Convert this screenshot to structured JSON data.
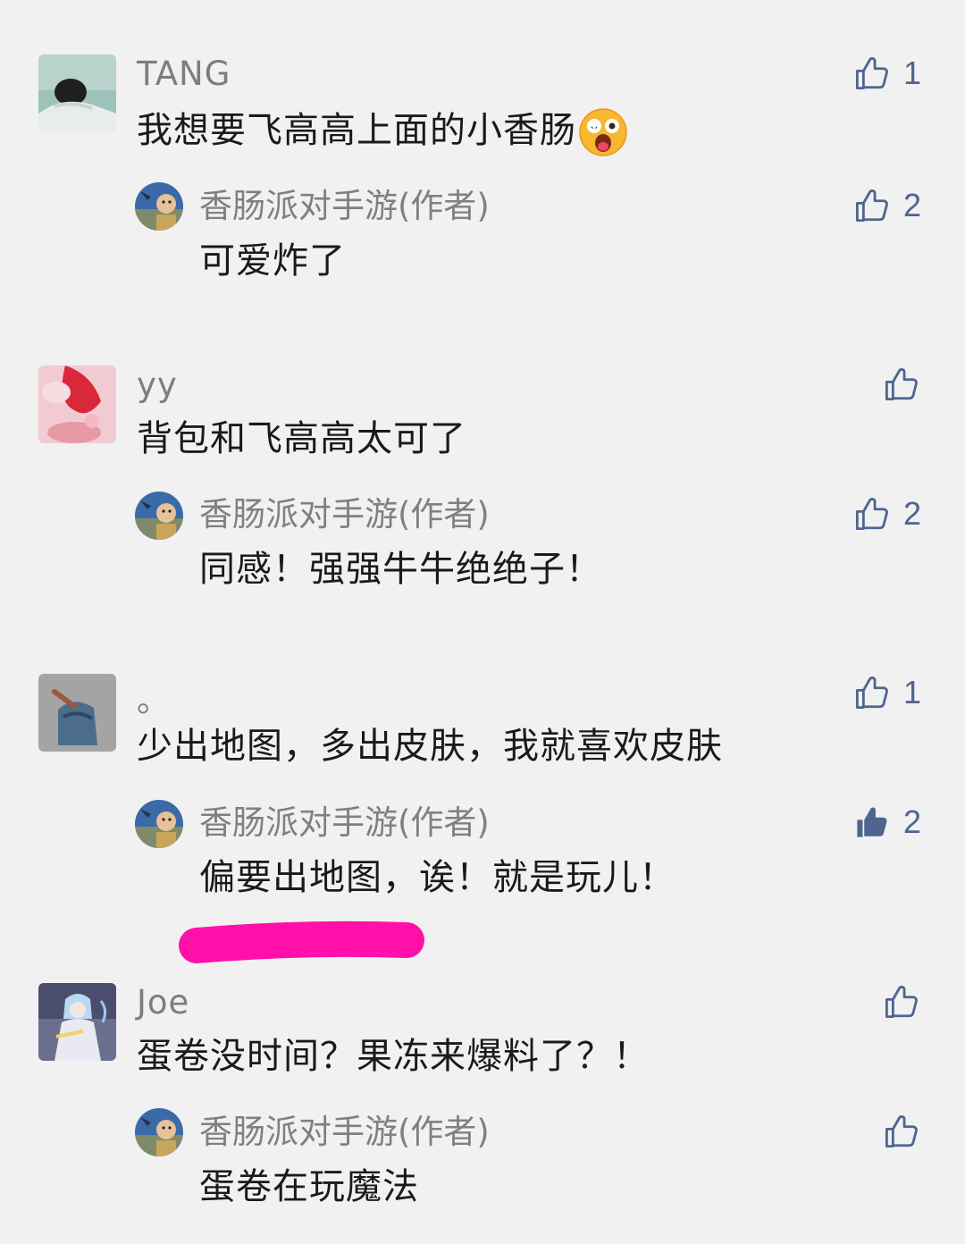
{
  "colors": {
    "background": "#f1f1f1",
    "like_icon": "#4f6590",
    "name_text": "#7d7d7d",
    "content_text": "#1a1a1a",
    "highlight_stroke": "#ff10a8"
  },
  "comments": [
    {
      "username": "TANG",
      "text": "我想要飞高高上面的小香肠",
      "emoji": "astonished-face-icon",
      "likes": "1",
      "reply": {
        "author": "香肠派对手游(作者)",
        "text": "可爱炸了",
        "likes": "2",
        "liked": false
      }
    },
    {
      "username": "yy",
      "text": "背包和飞高高太可了",
      "likes": "",
      "reply": {
        "author": "香肠派对手游(作者)",
        "text": "同感！强强牛牛绝绝子！",
        "likes": "2",
        "liked": false
      }
    },
    {
      "username": "。",
      "text": "少出地图，多出皮肤，我就喜欢皮肤",
      "likes": "1",
      "reply": {
        "author": "香肠派对手游(作者)",
        "text": "偏要出地图，诶！就是玩儿！",
        "likes": "2",
        "liked": true
      }
    },
    {
      "username": "Joe",
      "text": "蛋卷没时间？果冻来爆料了？！",
      "likes": "",
      "reply": {
        "author": "香肠派对手游(作者)",
        "text": "蛋卷在玩魔法",
        "likes": "",
        "liked": false
      }
    }
  ]
}
